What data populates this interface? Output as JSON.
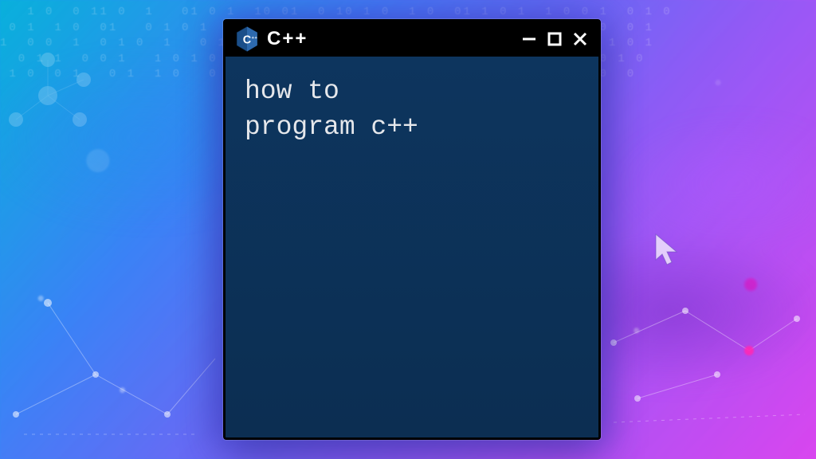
{
  "window": {
    "title": "C++",
    "icon_name": "cpp-logo-icon"
  },
  "content": {
    "text": "how to\nprogram c++"
  },
  "controls": {
    "minimize": "minimize",
    "maximize": "maximize",
    "close": "close"
  }
}
